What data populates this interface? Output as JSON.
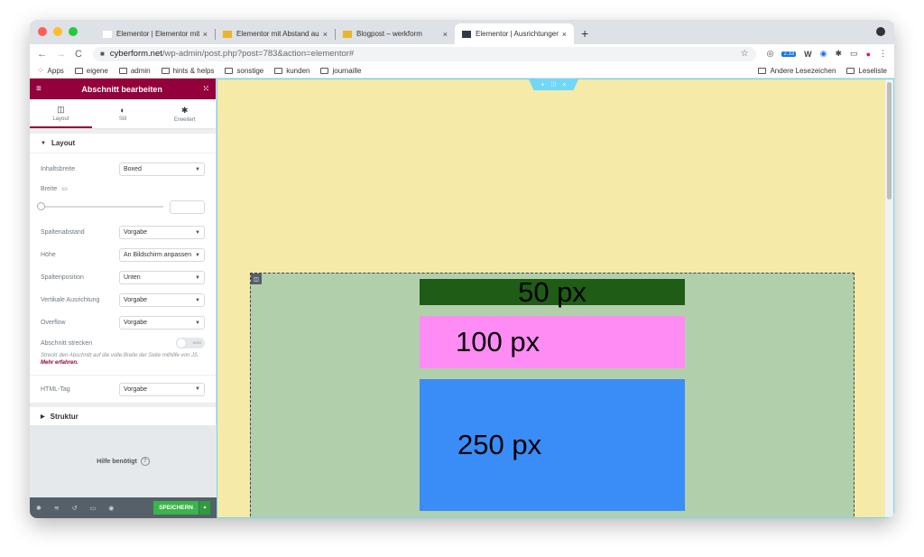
{
  "browser": {
    "traffic_lights": [
      "#ff5f57",
      "#febc2e",
      "#28c840"
    ],
    "tabs": [
      {
        "title": "Elementor | Elementor mit Abst",
        "favicon": "elementor-favicon",
        "active": false
      },
      {
        "title": "Elementor mit Abstand ausgeri",
        "favicon": "yellow-folder-favicon",
        "active": false
      },
      {
        "title": "Blogpost – werkform",
        "favicon": "yellow-folder-favicon",
        "active": false
      },
      {
        "title": "Elementor | Ausrichtungen",
        "favicon": "elementor-favicon",
        "active": true
      }
    ],
    "tab_close": "×",
    "new_tab": "+",
    "address": {
      "host": "cyberform.net",
      "path": "/wp-admin/post.php?post=783&action=elementor#"
    },
    "badge": "2.33",
    "bookmarks": [
      "Apps",
      "eigene",
      "admin",
      "hints & helps",
      "sonstige",
      "kunden",
      "journaille"
    ],
    "bookmarks_right": [
      "Andere Lesezeichen",
      "Leseliste"
    ]
  },
  "panel": {
    "title": "Abschnitt bearbeiten",
    "tabs": [
      {
        "label": "Layout",
        "icon": "columns-icon"
      },
      {
        "label": "Stil",
        "icon": "half-circle-icon"
      },
      {
        "label": "Erweitert",
        "icon": "gear-icon"
      }
    ],
    "section_layout": "Layout",
    "controls": {
      "content_width": {
        "label": "Inhaltsbreite",
        "value": "Boxed"
      },
      "width": {
        "label": "Breite"
      },
      "column_gap": {
        "label": "Spaltenabstand",
        "value": "Vorgabe"
      },
      "height": {
        "label": "Höhe",
        "value": "An Bildschirm anpassen"
      },
      "column_position": {
        "label": "Spaltenposition",
        "value": "Unten"
      },
      "vertical_align": {
        "label": "Vertikale Ausrichtung",
        "value": "Vorgabe"
      },
      "overflow": {
        "label": "Overflow",
        "value": "Vorgabe"
      },
      "stretch": {
        "label": "Abschnitt strecken",
        "toggle_text": "NEIN",
        "hint": "Streckt den Abschnitt auf die volle Breite der Seite mithilfe von JS.",
        "hint_link": "Mehr erfahren."
      },
      "html_tag": {
        "label": "HTML-Tag",
        "value": "Vorgabe"
      }
    },
    "section_structure": "Struktur",
    "help": "Hilfe benötigt",
    "save": "SPEICHERN",
    "accent": "#93003c"
  },
  "canvas": {
    "background": "#f5eaa8",
    "inner_background": "#b2cfac",
    "blocks": [
      {
        "label": "50 px",
        "color": "#1f5c16"
      },
      {
        "label": "100 px",
        "color": "#ff8cf5"
      },
      {
        "label": "250 px",
        "color": "#3a8cf6"
      }
    ]
  }
}
